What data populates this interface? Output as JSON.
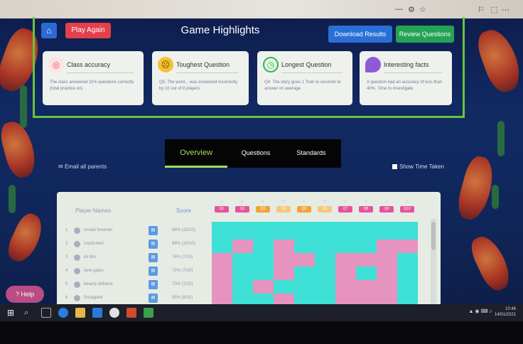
{
  "header": {
    "title": "Game Highlights",
    "play_again": "Play Again",
    "download_results": "Download Results",
    "review_questions": "Review Questions"
  },
  "cards": [
    {
      "title": "Class accuracy",
      "text": "The class answered 11% questions correctly (total practice on)",
      "icon": "target-icon",
      "icon_color": "#e8495a"
    },
    {
      "title": "Toughest Question",
      "text": "Q5: The word... was answered incorrectly by 10 out of 8 players",
      "icon": "sad-face-icon",
      "icon_color": "#f2c230"
    },
    {
      "title": "Longest Question",
      "text": "Q4: The story goes 1 Took to seconds to answer on average",
      "icon": "clock-icon",
      "icon_color": "#36b34a"
    },
    {
      "title": "Interesting facts",
      "text": "A question had an accuracy of less than 40%. Time to investigate",
      "icon": "speech-bubble-icon",
      "icon_color": "#8e5bd8"
    }
  ],
  "tabs": [
    "Overview",
    "Questions",
    "Standards"
  ],
  "active_tab": "Overview",
  "email_parents": "Email all parents",
  "show_time_taken": "Show Time Taken",
  "table": {
    "col_players": "Player Names",
    "col_score": "Score",
    "questions": [
      {
        "label": "Q1",
        "icon_color": "#e6539d"
      },
      {
        "label": "Q2",
        "icon_color": "#e6539d"
      },
      {
        "label": "Q3",
        "icon_color": "#f2a23a"
      },
      {
        "label": "Q4",
        "icon_color": "#f2c97a"
      },
      {
        "label": "Q5",
        "icon_color": "#f2a23a"
      },
      {
        "label": "Q6",
        "icon_color": "#f2c97a"
      },
      {
        "label": "Q7",
        "icon_color": "#e6539d"
      },
      {
        "label": "Q8",
        "icon_color": "#e6539d"
      },
      {
        "label": "Q9",
        "icon_color": "#e6539d"
      },
      {
        "label": "Q10",
        "icon_color": "#e6539d"
      }
    ],
    "players": [
      {
        "rank": "1",
        "name": "ronald freeman",
        "score": "98% (10/10)"
      },
      {
        "rank": "2",
        "name": "mazbutani",
        "score": "89% (10/10)"
      },
      {
        "rank": "3",
        "name": "ibi ibin",
        "score": "74% (7/10)"
      },
      {
        "rank": "4",
        "name": "lane gates",
        "score": "72% (7/10)"
      },
      {
        "rank": "5",
        "name": "beauty williams",
        "score": "70% (7/10)"
      },
      {
        "rank": "6",
        "name": "fiscalgiant",
        "score": "65% (6/10)"
      }
    ],
    "grid_colors": {
      "correct": "#3fe0d5",
      "incorrect": "#e693c0"
    }
  },
  "help_label": "Help",
  "taskbar": {
    "date_line1": "10:46",
    "date_line2": "14/01/2021"
  }
}
